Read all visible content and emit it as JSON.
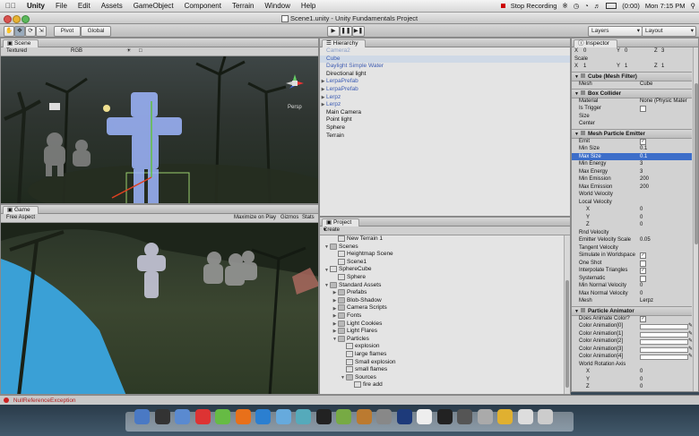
{
  "menubar": {
    "apple": "",
    "app": "Unity",
    "items": [
      "File",
      "Edit",
      "Assets",
      "GameObject",
      "Component",
      "Terrain",
      "Window",
      "Help"
    ],
    "recording": "Stop Recording",
    "battery": "(0:00)",
    "clock": "Mon 7:15 PM"
  },
  "window": {
    "title": "Scene1.unity - Unity Fundamentals Project"
  },
  "toolbar": {
    "pivot": "Pivot",
    "global": "Global",
    "layers": "Layers",
    "layout": "Layout"
  },
  "scene": {
    "tab": "Scene",
    "shading": "Textured",
    "render": "RGB",
    "gizmo_label": "Persp"
  },
  "game": {
    "tab": "Game",
    "aspect": "Free Aspect",
    "maximize": "Maximize on Play",
    "gizmos": "Gizmos",
    "stats": "Stats"
  },
  "hierarchy": {
    "tab": "Hierarchy",
    "items": [
      {
        "label": "Camera2",
        "fold": "",
        "style": "faded"
      },
      {
        "label": "Cube",
        "fold": "",
        "style": "sel"
      },
      {
        "label": "Daylight Simple Water",
        "fold": "",
        "style": "blue"
      },
      {
        "label": "Directional light",
        "fold": "",
        "style": ""
      },
      {
        "label": "LerpaPrefab",
        "fold": "▶",
        "style": "blue"
      },
      {
        "label": "LerpaPrefab",
        "fold": "▶",
        "style": "blue"
      },
      {
        "label": "Lerpz",
        "fold": "▶",
        "style": "blue"
      },
      {
        "label": "Lerpz",
        "fold": "▶",
        "style": "blue"
      },
      {
        "label": "Main Camera",
        "fold": "",
        "style": ""
      },
      {
        "label": "Point light",
        "fold": "",
        "style": ""
      },
      {
        "label": "Sphere",
        "fold": "",
        "style": ""
      },
      {
        "label": "Terrain",
        "fold": "",
        "style": ""
      }
    ]
  },
  "project": {
    "tab": "Project",
    "create": "Create",
    "items": [
      {
        "label": "New Terrain 1",
        "indent": 1,
        "fold": "",
        "type": "obj"
      },
      {
        "label": "Scenes",
        "indent": 0,
        "fold": "▼",
        "type": "folder"
      },
      {
        "label": "Heightmap Scene",
        "indent": 1,
        "fold": "",
        "type": "obj"
      },
      {
        "label": "Scene1",
        "indent": 1,
        "fold": "",
        "type": "obj"
      },
      {
        "label": "SphereCube",
        "indent": 0,
        "fold": "▼",
        "type": "obj"
      },
      {
        "label": "Sphere",
        "indent": 1,
        "fold": "",
        "type": "obj"
      },
      {
        "label": "Standard Assets",
        "indent": 0,
        "fold": "▼",
        "type": "folder"
      },
      {
        "label": "Prefabs",
        "indent": 1,
        "fold": "▶",
        "type": "folder"
      },
      {
        "label": "Blob-Shadow",
        "indent": 1,
        "fold": "▶",
        "type": "folder"
      },
      {
        "label": "Camera Scripts",
        "indent": 1,
        "fold": "▶",
        "type": "folder"
      },
      {
        "label": "Fonts",
        "indent": 1,
        "fold": "▶",
        "type": "folder"
      },
      {
        "label": "Light Cookies",
        "indent": 1,
        "fold": "▶",
        "type": "folder"
      },
      {
        "label": "Light Flares",
        "indent": 1,
        "fold": "▶",
        "type": "folder"
      },
      {
        "label": "Particles",
        "indent": 1,
        "fold": "▼",
        "type": "folder"
      },
      {
        "label": "explosion",
        "indent": 2,
        "fold": "",
        "type": "obj"
      },
      {
        "label": "large flames",
        "indent": 2,
        "fold": "",
        "type": "obj"
      },
      {
        "label": "Small explosion",
        "indent": 2,
        "fold": "",
        "type": "obj"
      },
      {
        "label": "small flames",
        "indent": 2,
        "fold": "",
        "type": "obj"
      },
      {
        "label": "Sources",
        "indent": 2,
        "fold": "▼",
        "type": "folder"
      },
      {
        "label": "fire add",
        "indent": 3,
        "fold": "",
        "type": "obj"
      }
    ]
  },
  "inspector": {
    "tab": "Inspector",
    "pos": {
      "x": "0",
      "y": "0",
      "z": "3"
    },
    "scale_label": "Scale",
    "scale": {
      "x": "1",
      "y": "1",
      "z": "1"
    },
    "mesh_filter": {
      "title": "Cube (Mesh Filter)",
      "mesh_label": "Mesh",
      "mesh_value": "Cube"
    },
    "box_collider": {
      "title": "Box Collider",
      "material_label": "Material",
      "material_value": "None (Physic Mater",
      "trigger_label": "Is Trigger",
      "size_label": "Size",
      "center_label": "Center"
    },
    "emitter": {
      "title": "Mesh Particle Emitter",
      "rows": [
        {
          "k": "Emit",
          "v": "✓",
          "check": true
        },
        {
          "k": "Min Size",
          "v": "0.1",
          "check": false
        },
        {
          "k": "Max Size",
          "v": "0.1",
          "check": false,
          "sel": true
        },
        {
          "k": "Min Energy",
          "v": "3",
          "check": false
        },
        {
          "k": "Max Energy",
          "v": "3",
          "check": false
        },
        {
          "k": "Min Emission",
          "v": "200",
          "check": false
        },
        {
          "k": "Max Emission",
          "v": "200",
          "check": false
        }
      ],
      "world_vel": "World Velocity",
      "local_vel": "Local Velocity",
      "lx": "0",
      "ly": "0",
      "lz": "0",
      "rnd_vel": "Rnd Velocity",
      "evs_label": "Emitter Velocity Scale",
      "evs_value": "0.05",
      "tan_vel": "Tangent Velocity",
      "flags": [
        {
          "k": "Simulate in Worldspace",
          "v": "✓"
        },
        {
          "k": "One Shot",
          "v": ""
        },
        {
          "k": "Interpolate Triangles",
          "v": "✓"
        },
        {
          "k": "Systematic",
          "v": ""
        }
      ],
      "min_nv_label": "Min Normal Velocity",
      "min_nv": "0",
      "max_nv_label": "Max Normal Velocity",
      "max_nv": "0",
      "mesh_label": "Mesh",
      "mesh_value": "Lerpz"
    },
    "animator": {
      "title": "Particle Animator",
      "does_anim_label": "Does Animate Color?",
      "does_anim": "✓",
      "colors": [
        "Color Animation[0]",
        "Color Animation[1]",
        "Color Animation[2]",
        "Color Animation[3]",
        "Color Animation[4]"
      ],
      "wra": "World Rotation Axis",
      "wx": "0",
      "wy": "0",
      "wz": "0"
    }
  },
  "status": {
    "error": "NullReferenceException"
  }
}
